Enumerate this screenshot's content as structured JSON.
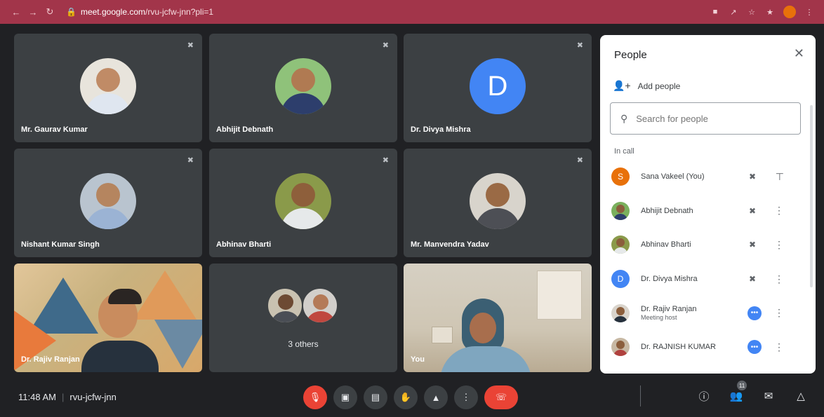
{
  "browser": {
    "url_host": "meet.google.com",
    "url_path": "/rvu-jcfw-jnn?pli=1"
  },
  "tiles": [
    {
      "name": "Mr. Gaurav Kumar"
    },
    {
      "name": "Abhijit Debnath"
    },
    {
      "name": "Dr. Divya Mishra",
      "initial": "D"
    },
    {
      "name": "Nishant Kumar Singh"
    },
    {
      "name": "Abhinav Bharti"
    },
    {
      "name": "Mr. Manvendra Yadav"
    },
    {
      "name": "Dr. Rajiv Ranjan"
    },
    {
      "others_label": "3 others"
    },
    {
      "name": "You"
    }
  ],
  "panel": {
    "title": "People",
    "add_people": "Add people",
    "search_placeholder": "Search for people",
    "section": "In call",
    "people": [
      {
        "name": "Sana Vakeel (You)",
        "initial": "S",
        "color": "#e8710a"
      },
      {
        "name": "Abhijit Debnath"
      },
      {
        "name": "Abhinav Bharti"
      },
      {
        "name": "Dr. Divya Mishra",
        "initial": "D",
        "color": "#4285f4"
      },
      {
        "name": "Dr. Rajiv Ranjan",
        "subtitle": "Meeting host"
      },
      {
        "name": "Dr. RAJNISH KUMAR"
      }
    ]
  },
  "bottom": {
    "time": "11:48 AM",
    "meeting_code": "rvu-jcfw-jnn",
    "participants_count": "11"
  },
  "colors": {
    "accent_red": "#ea4335",
    "browser_bar": "#a2354a",
    "tile_bg": "#3c4043"
  }
}
